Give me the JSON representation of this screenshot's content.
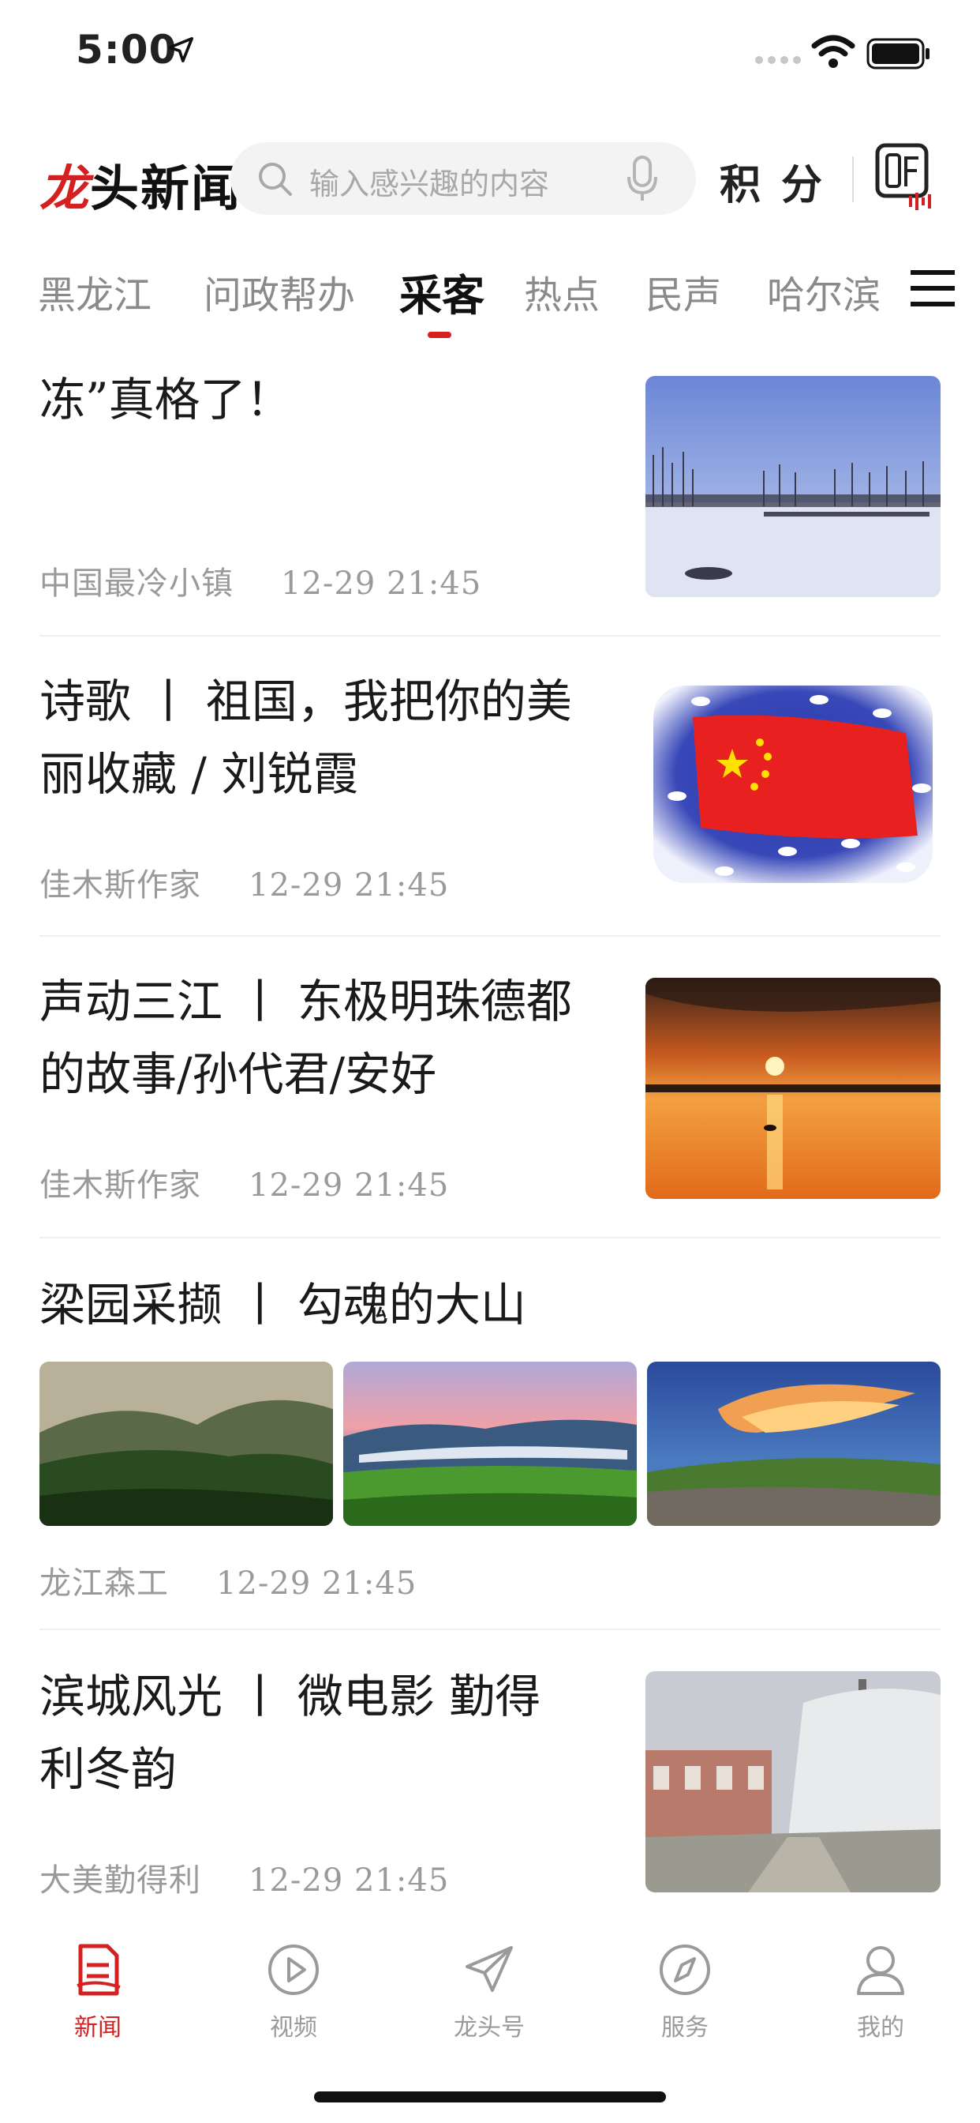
{
  "status_bar": {
    "time": "5:00"
  },
  "header": {
    "logo_red": "龙",
    "logo_rest": "头新闻",
    "search_placeholder": "输入感兴趣的内容",
    "points_label": "积分"
  },
  "tabs": [
    {
      "label": "黑龙江"
    },
    {
      "label": "问政帮办"
    },
    {
      "label": "采客"
    },
    {
      "label": "热点"
    },
    {
      "label": "民声"
    },
    {
      "label": "哈尔滨"
    }
  ],
  "articles": [
    {
      "title_line1": "冻”真格了！",
      "title_line2": "",
      "source": "中国最冷小镇",
      "time": "12-29  21:45"
    },
    {
      "title_line1": "诗歌 丨 祖国，我把你的美",
      "title_line2": "丽收藏 / 刘锐霞",
      "source": "佳木斯作家",
      "time": "12-29  21:45"
    },
    {
      "title_line1": "声动三江 丨 东极明珠德都",
      "title_line2": "的故事/孙代君/安好",
      "source": "佳木斯作家",
      "time": "12-29  21:45"
    },
    {
      "title_line1": "梁园采撷 丨 勾魂的大山",
      "title_line2": "",
      "source": "龙江森工",
      "time": "12-29  21:45"
    },
    {
      "title_line1": "滨城风光 丨 微电影 勤得",
      "title_line2": "利冬韵",
      "source": "大美勤得利",
      "time": "12-29  21:45"
    }
  ],
  "bottom_nav": [
    {
      "label": "新闻",
      "icon": "news-icon"
    },
    {
      "label": "视频",
      "icon": "video-icon"
    },
    {
      "label": "龙头号",
      "icon": "paper-plane-icon"
    },
    {
      "label": "服务",
      "icon": "compass-icon"
    },
    {
      "label": "我的",
      "icon": "user-icon"
    }
  ],
  "colors": {
    "accent": "#d42020",
    "muted": "#9a9a9a",
    "text": "#1a1a1a"
  }
}
